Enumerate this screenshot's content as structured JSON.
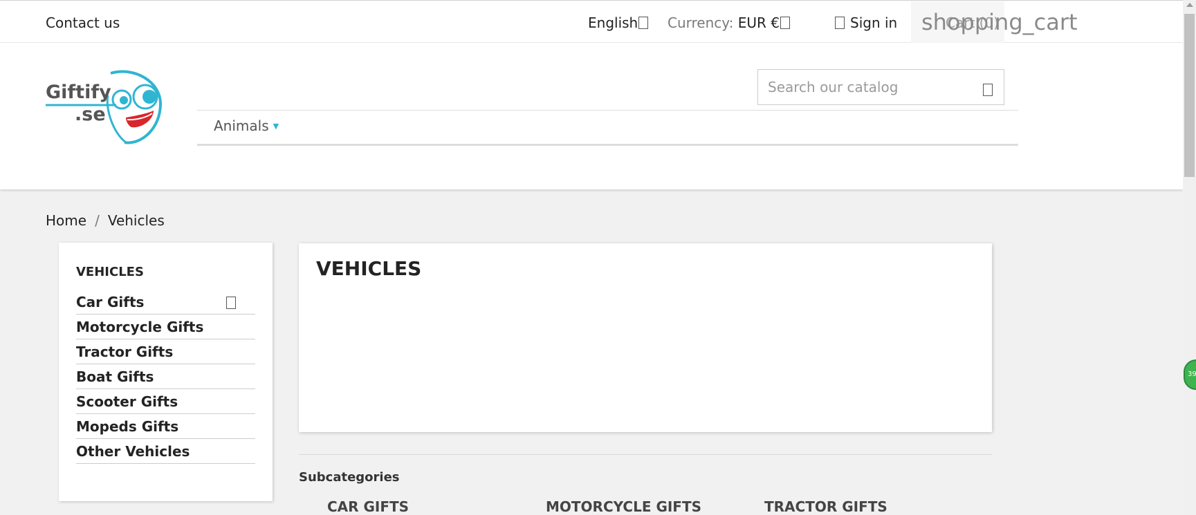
{
  "topbar": {
    "contact": "Contact us",
    "language": "English",
    "currency_label": "Currency:",
    "currency_value": "EUR €",
    "signin": "Sign in",
    "cart_icon_text": "shopping_cart",
    "cart_text": "Cart (0)"
  },
  "header": {
    "logo_text": "Giftify.se",
    "search_placeholder": "Search our catalog",
    "nav": [
      {
        "label": "Animals"
      }
    ]
  },
  "breadcrumb": {
    "home": "Home",
    "separator": "/",
    "current": "Vehicles"
  },
  "sidebar": {
    "title": "VEHICLES",
    "items": [
      {
        "label": "Car Gifts"
      },
      {
        "label": "Motorcycle Gifts"
      },
      {
        "label": "Tractor Gifts"
      },
      {
        "label": "Boat Gifts"
      },
      {
        "label": "Scooter Gifts"
      },
      {
        "label": "Mopeds Gifts"
      },
      {
        "label": "Other Vehicles"
      }
    ]
  },
  "main": {
    "title": "VEHICLES",
    "subcategories_title": "Subcategories",
    "subcategories": [
      "CAR GIFTS",
      "MOTORCYCLE GIFTS",
      "TRACTOR GIFTS"
    ]
  },
  "chat_badge": "39",
  "colors": {
    "accent": "#2fb5d2",
    "background": "#f1f1f1",
    "logo_red": "#d7262c"
  }
}
